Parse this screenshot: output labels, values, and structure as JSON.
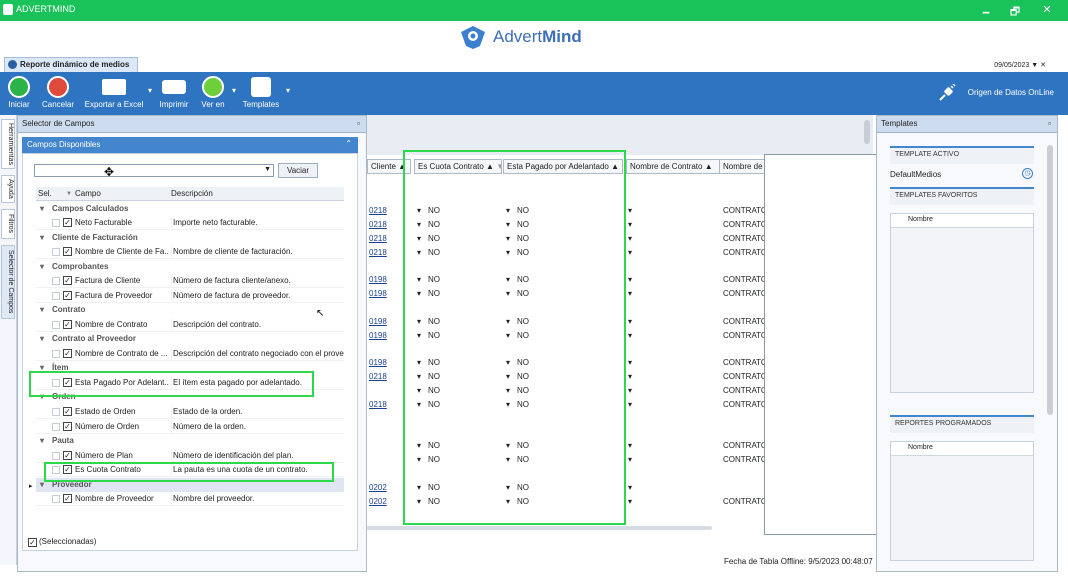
{
  "window": {
    "title": "ADVERTMIND",
    "minimize": "🗕",
    "restore": "🗗",
    "close": "✕"
  },
  "logo": {
    "text_a": "Advert",
    "text_b": "Mind"
  },
  "doc_tab": {
    "label": "Reporte dinámico de medios"
  },
  "date": "09/05/2023",
  "ribbon": {
    "buttons": [
      {
        "label": "Iniciar",
        "icon": "play-icon",
        "color": "#2bb34a"
      },
      {
        "label": "Cancelar",
        "icon": "cancel-icon",
        "color": "#e04a3c"
      },
      {
        "label": "Exportar a Excel",
        "icon": "excel-icon",
        "color": "#ffffff"
      },
      {
        "label": "Imprimir",
        "icon": "printer-icon",
        "color": "#ffffff"
      },
      {
        "label": "Ver en",
        "icon": "eye-icon",
        "color": "#6fcf3a"
      },
      {
        "label": "Templates",
        "icon": "save-icon",
        "color": "#ffffff"
      }
    ],
    "online_label": "Origen de Datos OnLine"
  },
  "left_tabs": [
    "Herramientas",
    "Ayuda",
    "Filtros",
    "Selector de Campos"
  ],
  "selector": {
    "panel_title": "Selector de Campos",
    "subpanel_title": "Campos Disponibles",
    "search_value": "",
    "clear_label": "Vaciar",
    "headers": {
      "sel": "Sel.",
      "campo": "Campo",
      "desc": "Descripción"
    },
    "rows": [
      {
        "type": "group",
        "name": "Campos Calculados"
      },
      {
        "type": "item",
        "name": "Neto Facturable",
        "desc": "Importe neto facturable."
      },
      {
        "type": "group",
        "name": "Cliente de Facturación"
      },
      {
        "type": "item",
        "name": "Nombre de Cliente de Fa...",
        "desc": "Nombre de cliente de facturación."
      },
      {
        "type": "group",
        "name": "Comprobantes"
      },
      {
        "type": "item",
        "name": "Factura de Cliente",
        "desc": "Número de factura cliente/anexo."
      },
      {
        "type": "item",
        "name": "Factura de Proveedor",
        "desc": "Número de factura de proveedor."
      },
      {
        "type": "group",
        "name": "Contrato"
      },
      {
        "type": "item",
        "name": "Nombre de Contrato",
        "desc": "Descripción del contrato."
      },
      {
        "type": "group",
        "name": "Contrato al Proveedor"
      },
      {
        "type": "item",
        "name": "Nombre de Contrato de ...",
        "desc": "Descripción del contrato negociado con el provee..."
      },
      {
        "type": "group",
        "name": "Ítem"
      },
      {
        "type": "item",
        "name": "Esta Pagado Por Adelant...",
        "desc": "El ítem esta pagado por adelantado."
      },
      {
        "type": "group",
        "name": "Orden"
      },
      {
        "type": "item",
        "name": "Estado de Orden",
        "desc": "Estado de la orden."
      },
      {
        "type": "item",
        "name": "Número de Orden",
        "desc": "Número de la orden."
      },
      {
        "type": "group",
        "name": "Pauta"
      },
      {
        "type": "item",
        "name": "Número de Plan",
        "desc": "Número de identificación del plan."
      },
      {
        "type": "item",
        "name": "Es Cuota Contrato",
        "desc": "La pauta es una cuota de un contrato."
      },
      {
        "type": "group",
        "name": "Proveedor"
      },
      {
        "type": "item",
        "name": "Nombre de Proveedor",
        "desc": "Nombre del proveedor."
      }
    ],
    "footer": "(Seleccionadas)"
  },
  "grid": {
    "columns": [
      "Cliente",
      "Es Cuota Contrato",
      "Esta Pagado por Adelantado",
      "Nombre de Contrato",
      "Nombre de C"
    ],
    "rows": [
      {
        "cliente": "0218",
        "cuota": "NO",
        "pagado": "NO",
        "contrato": "CONTRATO"
      },
      {
        "cliente": "0218",
        "cuota": "NO",
        "pagado": "NO",
        "contrato": "CONTRATO"
      },
      {
        "cliente": "0218",
        "cuota": "NO",
        "pagado": "NO",
        "contrato": "CONTRATO"
      },
      {
        "cliente": "0218",
        "cuota": "NO",
        "pagado": "NO",
        "contrato": "CONTRATO"
      },
      {
        "cliente": "0198",
        "cuota": "NO",
        "pagado": "NO",
        "contrato": "CONTRATO"
      },
      {
        "cliente": "0198",
        "cuota": "NO",
        "pagado": "NO",
        "contrato": "CONTRATO"
      },
      {
        "cliente": "0198",
        "cuota": "NO",
        "pagado": "NO",
        "contrato": "CONTRATO"
      },
      {
        "cliente": "0198",
        "cuota": "NO",
        "pagado": "NO",
        "contrato": "CONTRATO"
      },
      {
        "cliente": "0198",
        "cuota": "NO",
        "pagado": "NO",
        "contrato": "CONTRATO"
      },
      {
        "cliente": "0218",
        "cuota": "NO",
        "pagado": "NO",
        "contrato": "CONTRATO"
      },
      {
        "cliente": "",
        "cuota": "NO",
        "pagado": "NO",
        "contrato": "CONTRATO"
      },
      {
        "cliente": "0218",
        "cuota": "NO",
        "pagado": "NO",
        "contrato": "CONTRATO"
      },
      {
        "cliente": "",
        "cuota": "NO",
        "pagado": "NO",
        "contrato": "CONTRATO"
      },
      {
        "cliente": "",
        "cuota": "NO",
        "pagado": "NO",
        "contrato": "CONTRATO"
      },
      {
        "cliente": "0202",
        "cuota": "NO",
        "pagado": "NO",
        "contrato": ""
      },
      {
        "cliente": "0202",
        "cuota": "NO",
        "pagado": "NO",
        "contrato": "CONTRATO"
      }
    ],
    "offline_date": "Fecha de Tabla Offline: 9/5/2023 00:48:07"
  },
  "templates": {
    "panel_title": "Templates",
    "active_label": "TEMPLATE ACTIVO",
    "active_value": "DefaultMedios",
    "favorites_label": "TEMPLATES FAVORITOS",
    "favorites_col": "Nombre",
    "scheduled_label": "REPORTES PROGRAMADOS",
    "scheduled_col": "Nombre"
  }
}
